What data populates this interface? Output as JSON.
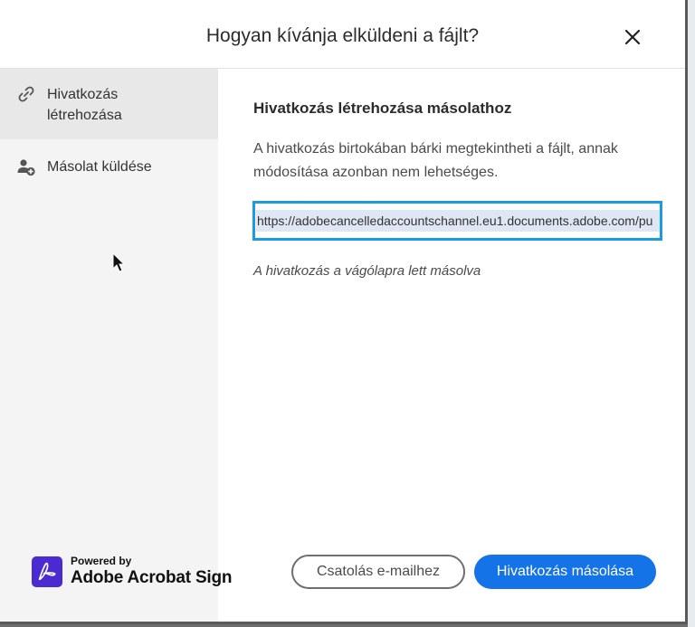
{
  "dialog": {
    "title": "Hogyan kívánja elküldeni a fájlt?",
    "close_icon": "close-icon"
  },
  "sidebar": {
    "items": [
      {
        "label_line1": "Hivatkozás",
        "label_line2": "létrehozása",
        "icon": "link-icon",
        "active": true
      },
      {
        "label": "Másolat küldése",
        "icon": "add-person-icon",
        "active": false
      }
    ],
    "brand": {
      "powered_by": "Powered by",
      "name": "Adobe Acrobat Sign",
      "icon": "acrobat-logo"
    }
  },
  "main": {
    "section_title": "Hivatkozás létrehozása másolathoz",
    "description": "A hivatkozás birtokában bárki megtekintheti a fájlt, annak módosítása azonban nem lehetséges.",
    "link_value": "https://adobecancelledaccountschannel.eu1.documents.adobe.com/pu",
    "copied_message": "A hivatkozás a vágólapra lett másolva"
  },
  "footer": {
    "attach_email_label": "Csatolás e-mailhez",
    "copy_link_label": "Hivatkozás másolása"
  },
  "colors": {
    "primary": "#1473e6",
    "focus_border": "#1e9be0",
    "brand_purple": "#4b2bd1"
  }
}
